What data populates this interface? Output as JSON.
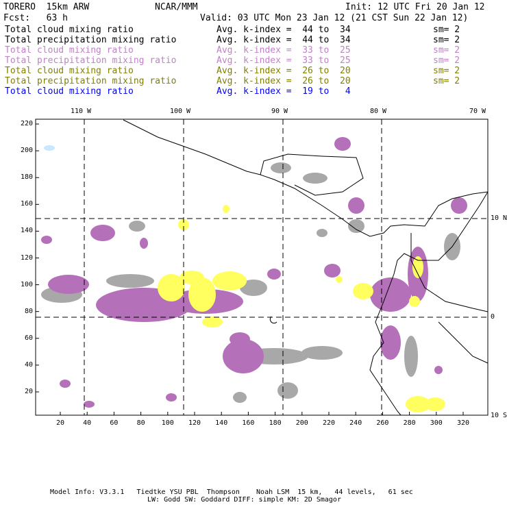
{
  "header": {
    "model": "TORERO  15km ARW",
    "org": "NCAR/MMM",
    "init": "Init: 12 UTC Fri 20 Jan 12",
    "fcst": "Fcst:   63 h",
    "valid": "Valid: 03 UTC Mon 23 Jan 12 (21 CST Sun 22 Jan 12)"
  },
  "legend": [
    {
      "field": "Total cloud mixing ratio",
      "range": "Avg. k-index =  44 to  34",
      "sm": "sm= 2",
      "color": "#000000"
    },
    {
      "field": "Total precipitation mixing ratio",
      "range": "Avg. k-index =  44 to  34",
      "sm": "sm= 2",
      "color": "#000000"
    },
    {
      "field": "Total cloud mixing ratio",
      "range": "Avg. k-index =  33 to  25",
      "sm": "sm= 2",
      "color": "#c080c8"
    },
    {
      "field": "Total precipitation mixing ratio",
      "range": "Avg. k-index =  33 to  25",
      "sm": "sm= 2",
      "color": "#c080c8"
    },
    {
      "field": "Total cloud mixing ratio",
      "range": "Avg. k-index =  26 to  20",
      "sm": "sm= 2",
      "color": "#808000"
    },
    {
      "field": "Total precipitation mixing ratio",
      "range": "Avg. k-index =  26 to  20",
      "sm": "sm= 2",
      "color": "#808000"
    },
    {
      "field": "Total cloud mixing ratio",
      "range": "Avg. k-index =  19 to   4",
      "sm": "",
      "color": "#0000ff"
    }
  ],
  "axes": {
    "top_lon": [
      "110 W",
      "100 W",
      "90 W",
      "80 W",
      "70 W"
    ],
    "right_lat": [
      "10 N",
      "0",
      "10 S"
    ],
    "left_y": [
      "220",
      "200",
      "180",
      "160",
      "140",
      "120",
      "100",
      "80",
      "60",
      "40",
      "20"
    ],
    "bottom_x": [
      "20",
      "40",
      "60",
      "80",
      "100",
      "120",
      "140",
      "160",
      "180",
      "200",
      "220",
      "240",
      "260",
      "280",
      "300",
      "320"
    ]
  },
  "footer": {
    "line1": "Model Info: V3.3.1   Tiedtke YSU PBL  Thompson    Noah LSM  15 km,   44 levels,   61 sec",
    "line2": "LW: Godd SW: Goddard DIFF: simple KM: 2D Smagor"
  },
  "colors": {
    "gray": "#a8a8a8",
    "purple": "#b470b8",
    "yellow": "#ffff60",
    "blue": "#c8e8ff"
  }
}
